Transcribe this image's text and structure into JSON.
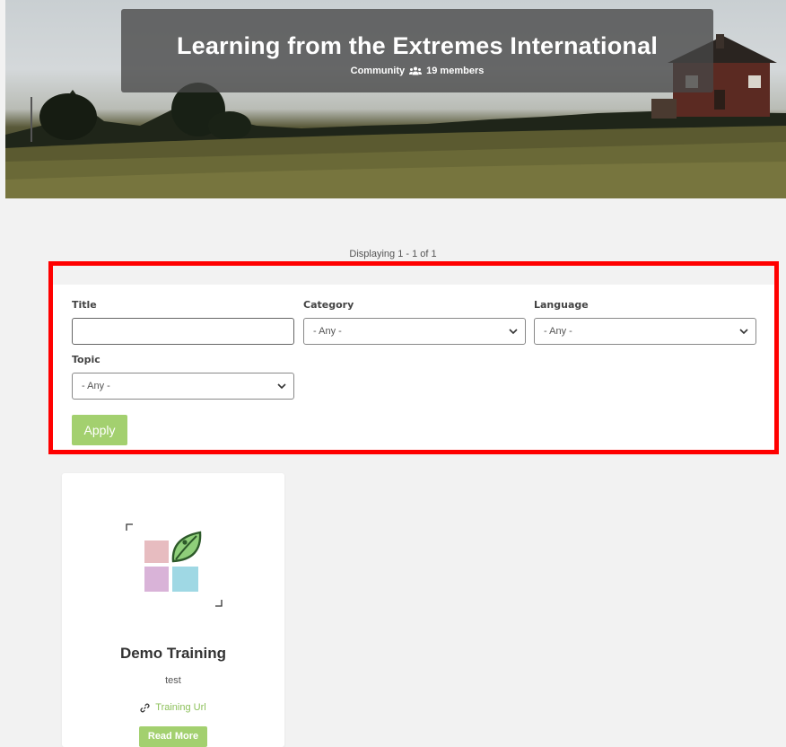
{
  "hero": {
    "title": "Learning from the Extremes International",
    "community_label": "Community",
    "members_label": "19 members",
    "members_icon": "users-icon"
  },
  "listing": {
    "display_count": "Displaying 1 - 1 of 1"
  },
  "filters": {
    "title_label": "Title",
    "title_value": "",
    "category_label": "Category",
    "category_value": "- Any -",
    "language_label": "Language",
    "language_value": "- Any -",
    "topic_label": "Topic",
    "topic_value": "- Any -",
    "apply_label": "Apply",
    "highlight_color": "#ff0000"
  },
  "cards": [
    {
      "title": "Demo Training",
      "description": "test",
      "link_label": "Training Url",
      "link_icon": "link-icon",
      "button_label": "Read More"
    }
  ],
  "colors": {
    "accent_green": "#a3d06f",
    "link_green": "#8cc05a",
    "page_bg": "#f2f2f2"
  }
}
